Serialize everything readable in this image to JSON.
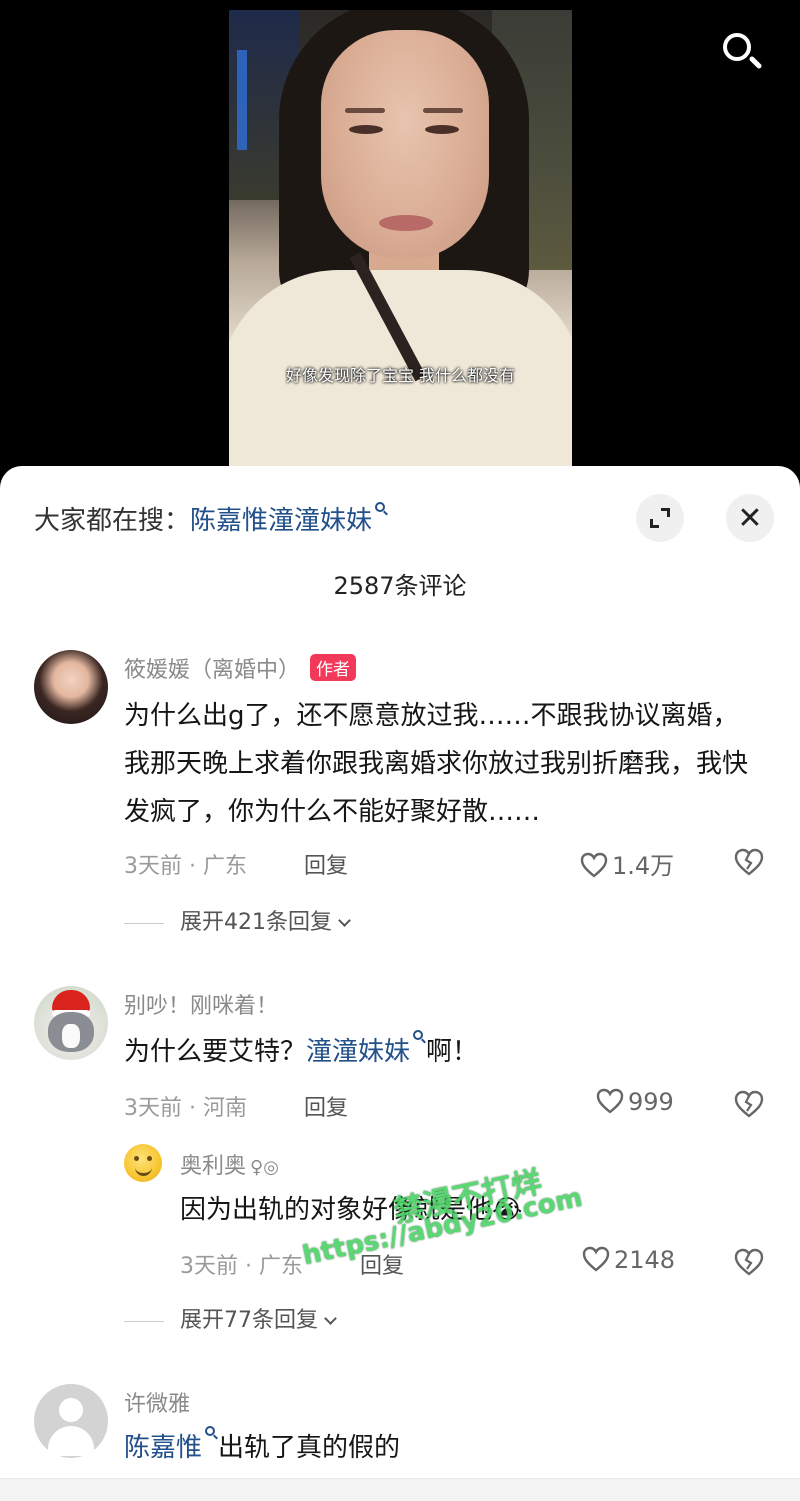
{
  "video": {
    "subtitle": "好像发现除了宝宝 我什么都没有"
  },
  "header": {
    "search_prefix": "大家都在搜：",
    "search_keyword": "陈嘉惟潼潼妹妹",
    "comment_count_title": "2587条评论"
  },
  "comments": [
    {
      "username": "筱媛媛（离婚中）",
      "badge": "作者",
      "text": "为什么出g了，还不愿意放过我……不跟我协议离婚，我那天晚上求着你跟我离婚求你放过我别折磨我，我快发疯了，你为什么不能好聚好散……",
      "meta": "3天前 · 广东",
      "reply_label": "回复",
      "likes": "1.4万",
      "expand_label": "展开421条回复"
    },
    {
      "username": "别吵！刚咪着！",
      "text_before": "为什么要艾特？",
      "text_keyword": "潼潼妹妹",
      "text_after": "啊！",
      "meta": "3天前 · 河南",
      "reply_label": "回复",
      "likes": "999",
      "reply": {
        "username": "奥利奥",
        "text": "因为出轨的对象好像就是他😭",
        "meta": "3天前 · 广东",
        "reply_label": "回复",
        "likes": "2148"
      },
      "expand_label": "展开77条回复"
    },
    {
      "username": "许微雅",
      "text_keyword": "陈嘉惟",
      "text_after": "出轨了真的假的"
    }
  ],
  "watermark": {
    "line1": "禁漫不打烊",
    "line2": "https://abdy20.com"
  },
  "colors": {
    "keyword": "#22508a",
    "author_badge": "#f2395a",
    "watermark": "#4ad364"
  }
}
